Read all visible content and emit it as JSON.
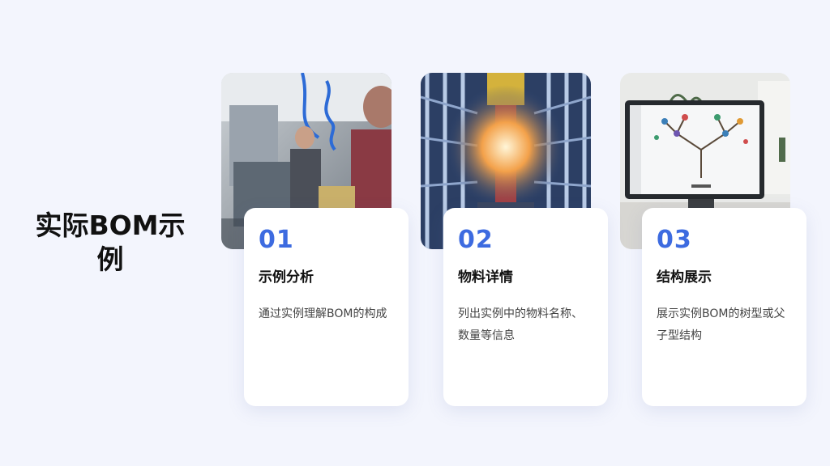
{
  "slide": {
    "title": "实际BOM示例"
  },
  "cards": [
    {
      "number": "01",
      "heading": "示例分析",
      "description": "通过实例理解BOM的构成",
      "image": "factory-workers-photo"
    },
    {
      "number": "02",
      "heading": "物料详情",
      "description": "列出实例中的物料名称、数量等信息",
      "image": "warehouse-racks-photo"
    },
    {
      "number": "03",
      "heading": "结构展示",
      "description": "展示实例BOM的树型或父子型结构",
      "image": "bom-tree-monitor-photo"
    }
  ],
  "colors": {
    "background": "#f3f5fd",
    "accent": "#3d6be0",
    "card": "#ffffff"
  }
}
